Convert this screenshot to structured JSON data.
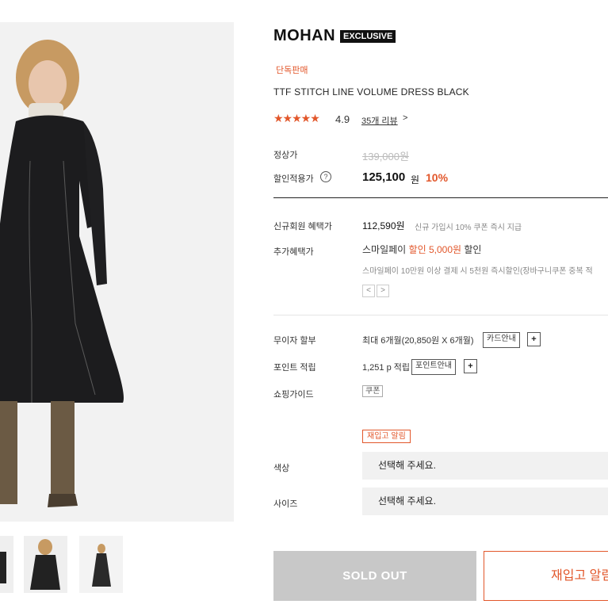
{
  "product": {
    "brand": "MOHAN",
    "brand_badge": "EXCLUSIVE",
    "exclusive_label": "단독판매",
    "name": "TTF STITCH LINE VOLUME DRESS BLACK",
    "stars": "★★★★★",
    "rating": "4.9",
    "reviews_link": "35개 리뷰",
    "reviews_chevron": ">"
  },
  "pricing": {
    "regular_label": "정상가",
    "regular_price": "139,000원",
    "discount_label": "할인적용가",
    "discount_help": "?",
    "discount_price": "125,100",
    "discount_unit": "원",
    "discount_rate": "10%"
  },
  "benefits": {
    "new_member_label": "신규회원 혜택가",
    "new_member_price": "112,590원",
    "new_member_note": "신규 가입시 10% 쿠폰 즉시 지급",
    "extra_label": "추가혜택가",
    "smilepay_prefix": "스마일페이 ",
    "smilepay_discount": "할인 5,000원",
    "smilepay_suffix": " 할인",
    "smilepay_note": "스마일페이 10만원 이상 결제 시 5천원 즉시할인(장바구니쿠폰 중복 적",
    "pager_prev": "<",
    "pager_next": ">"
  },
  "payment": {
    "installment_label": "무이자 할부",
    "installment_value": "최대 6개월(20,850원 X 6개월)",
    "card_guide_button": "카드안내",
    "plus": "+",
    "points_label": "포인트 적립",
    "points_value": "1,251 p 적립",
    "points_guide_button": "포인트안내",
    "shopping_guide_label": "쇼핑가이드",
    "coupon_chip": "쿠폰"
  },
  "options": {
    "restock_chip": "재입고 알림",
    "color_label": "색상",
    "color_placeholder": "선택해 주세요.",
    "size_label": "사이즈",
    "size_placeholder": "선택해 주세요."
  },
  "actions": {
    "sold_out": "SOLD OUT",
    "restock_notify": "재입고 알림"
  },
  "colors": {
    "accent": "#e2572b",
    "dark": "#111111",
    "disabled": "#c8c8c8"
  },
  "icons": [
    "star-icon",
    "help-icon",
    "chevron-left-icon",
    "chevron-right-icon",
    "plus-icon"
  ]
}
